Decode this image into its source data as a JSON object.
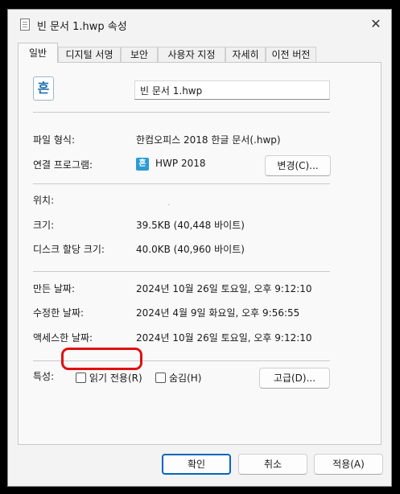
{
  "window": {
    "title": "빈 문서 1.hwp 속성",
    "close_symbol": "✕"
  },
  "tabs": [
    {
      "label": "일반",
      "active": true
    },
    {
      "label": "디지털 서명",
      "active": false
    },
    {
      "label": "보안",
      "active": false
    },
    {
      "label": "사용자 지정",
      "active": false
    },
    {
      "label": "자세히",
      "active": false
    },
    {
      "label": "이전 버전",
      "active": false
    }
  ],
  "general": {
    "app_icon_glyph": "흔",
    "file_name": "빈 문서 1.hwp",
    "file_type_label": "파일 형식:",
    "file_type_value": "한컴오피스 2018 한글 문서(.hwp)",
    "opens_with_label": "연결 프로그램:",
    "opens_with_icon_glyph": "흔",
    "opens_with_value": "HWP 2018",
    "change_button": "변경(C)...",
    "location_label": "위치:",
    "location_value": "",
    "size_label": "크기:",
    "size_value": "39.5KB (40,448 바이트)",
    "disk_size_label": "디스크 할당 크기:",
    "disk_size_value": "40.0KB (40,960 바이트)",
    "created_label": "만든 날짜:",
    "created_value": "2024년 10월 26일 토요일, 오후 9:12:10",
    "modified_label": "수정한 날짜:",
    "modified_value": "2024년 4월 9일 화요일, 오후 9:56:55",
    "accessed_label": "액세스한 날짜:",
    "accessed_value": "2024년 10월 26일 토요일, 오후 9:12:10",
    "attributes_label": "특성:",
    "readonly_label": "읽기 전용(R)",
    "readonly_checked": false,
    "hidden_label": "숨김(H)",
    "hidden_checked": false,
    "advanced_button": "고급(D)..."
  },
  "footer": {
    "ok": "확인",
    "cancel": "취소",
    "apply": "적용(A)"
  },
  "colors": {
    "highlight": "#e01010",
    "accent": "#0067c0",
    "hwp_icon": "#2a9bd5"
  }
}
